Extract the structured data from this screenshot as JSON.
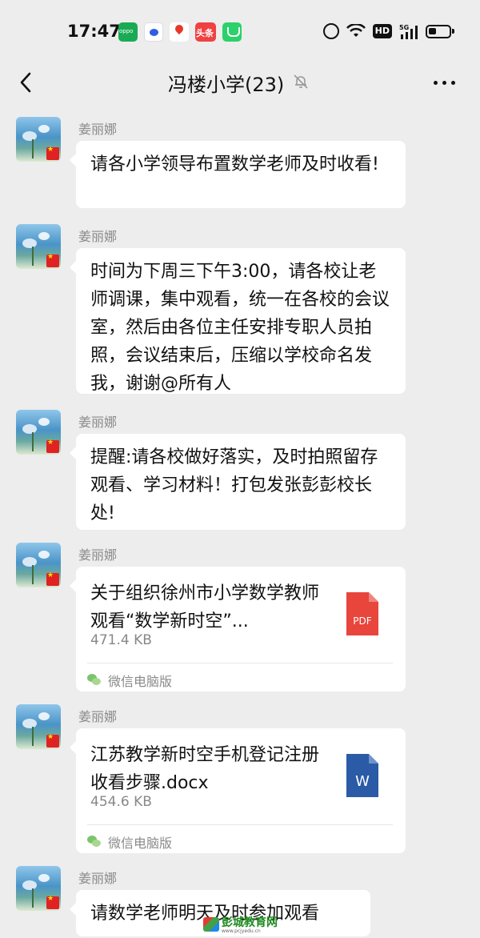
{
  "status_bar": {
    "time": "17:47",
    "app_icons": [
      "oppo-icon",
      "baidu-icon",
      "map-icon",
      "toutiao-icon",
      "green-app-icon"
    ],
    "toutiao_label": "头条",
    "hd_label": "HD",
    "network_label": "5G"
  },
  "nav": {
    "title": "冯楼小学(23)"
  },
  "messages": [
    {
      "sender": "姜丽娜",
      "text": "请各小学领导布置数学老师及时收看!"
    },
    {
      "sender": "姜丽娜",
      "text": "时间为下周三下午3:00，请各校让老师调课，集中观看，统一在各校的会议室，然后由各位主任安排专职人员拍照，会议结束后，压缩以学校命名发我，谢谢@所有人"
    },
    {
      "sender": "姜丽娜",
      "text": "提醒:请各校做好落实，及时拍照留存观看、学习材料！打包发张彭彭校长处!"
    },
    {
      "sender": "姜丽娜",
      "file_name": "关于组织徐州市小学数学教师观看“数学新时空”...",
      "file_size": "471.4 KB",
      "file_type": "PDF",
      "source": "微信电脑版"
    },
    {
      "sender": "姜丽娜",
      "file_name": "江苏教学新时空手机登记注册收看步骤.docx",
      "file_size": "454.6 KB",
      "file_type": "W",
      "source": "微信电脑版"
    },
    {
      "sender": "姜丽娜",
      "text": "请数学老师明天及时参加观看"
    }
  ],
  "watermark": {
    "main": "彭城教育网",
    "url": "www.pcjyedu.cn"
  },
  "colors": {
    "background": "#ededed",
    "bubble": "#ffffff",
    "pdf_red": "#e8453c",
    "word_blue": "#2b5aa6"
  }
}
